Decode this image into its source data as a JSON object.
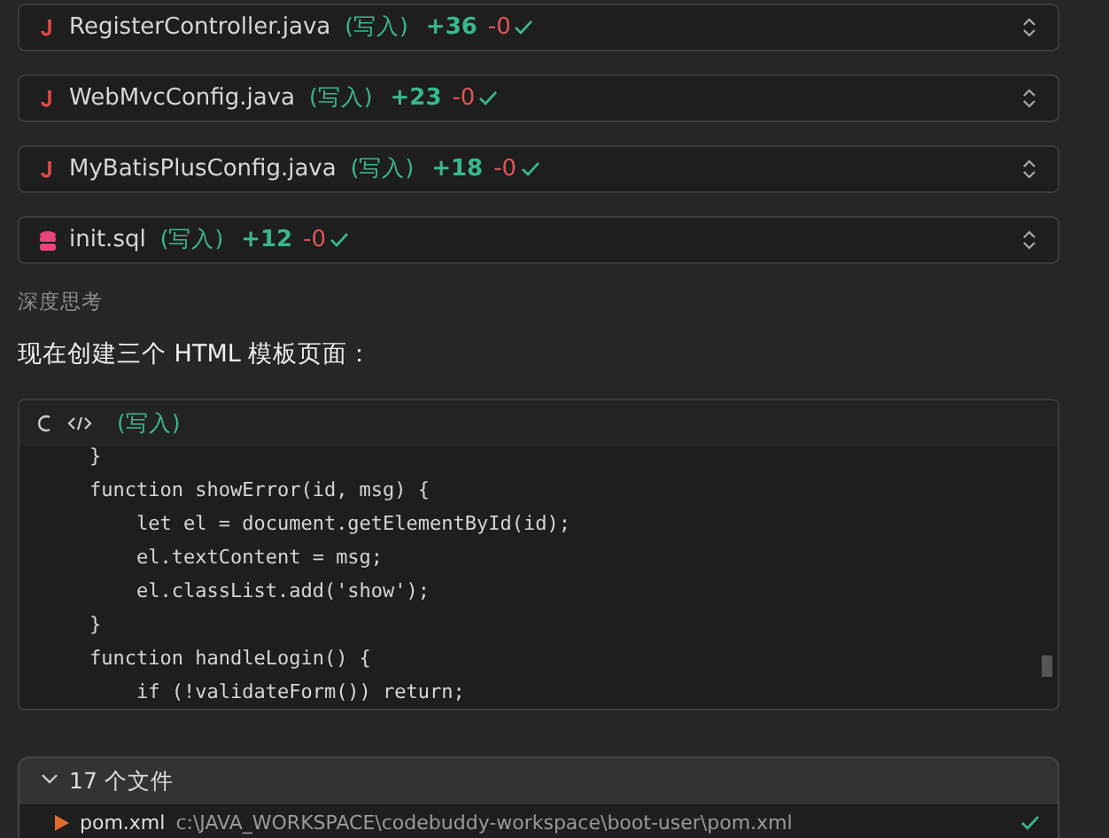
{
  "file_changes": [
    {
      "kind": "java",
      "name": "RegisterController.java",
      "status": "(写入)",
      "added": "+36",
      "removed": "-0",
      "done": true
    },
    {
      "kind": "java",
      "name": "WebMvcConfig.java",
      "status": "(写入)",
      "added": "+23",
      "removed": "-0",
      "done": true
    },
    {
      "kind": "java",
      "name": "MyBatisPlusConfig.java",
      "status": "(写入)",
      "added": "+18",
      "removed": "-0",
      "done": true
    },
    {
      "kind": "sql",
      "name": "init.sql",
      "status": "(写入)",
      "added": "+12",
      "removed": "-0",
      "done": true
    }
  ],
  "thinking_label": "深度思考",
  "message": "现在创建三个 HTML 模板页面：",
  "code_block": {
    "loading": true,
    "status": "(写入)",
    "lines": [
      "    }",
      "    function showError(id, msg) {",
      "        let el = document.getElementById(id);",
      "        el.textContent = msg;",
      "        el.classList.add('show');",
      "    }",
      "    function handleLogin() {",
      "        if (!validateForm()) return;"
    ]
  },
  "files_panel": {
    "expanded": true,
    "title": "17 个文件",
    "files": [
      {
        "name": "pom.xml",
        "path": "c:\\JAVA_WORKSPACE\\codebuddy-workspace\\boot-user\\pom.xml",
        "done": true
      }
    ]
  }
}
